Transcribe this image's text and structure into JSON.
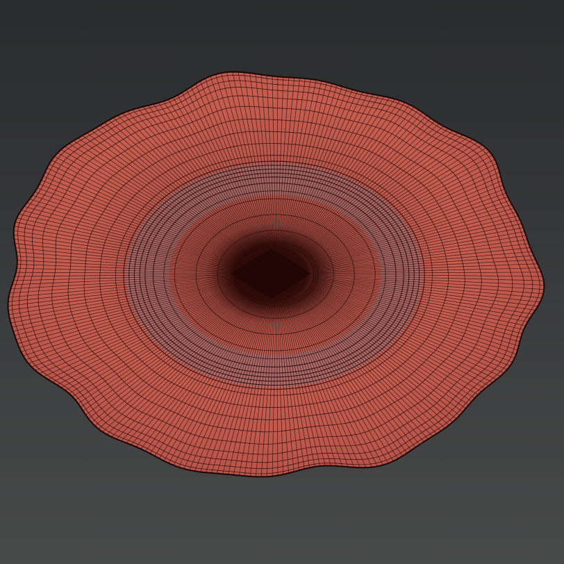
{
  "viewport": {
    "background_top": "#2a2b2c",
    "background_bottom": "#484949"
  },
  "model": {
    "object": "plate-mesh",
    "shading": "wireframe-on-shaded",
    "surface_color": "#c0584c",
    "wire_color": "#2a0d0b",
    "center_color": "#220605"
  }
}
